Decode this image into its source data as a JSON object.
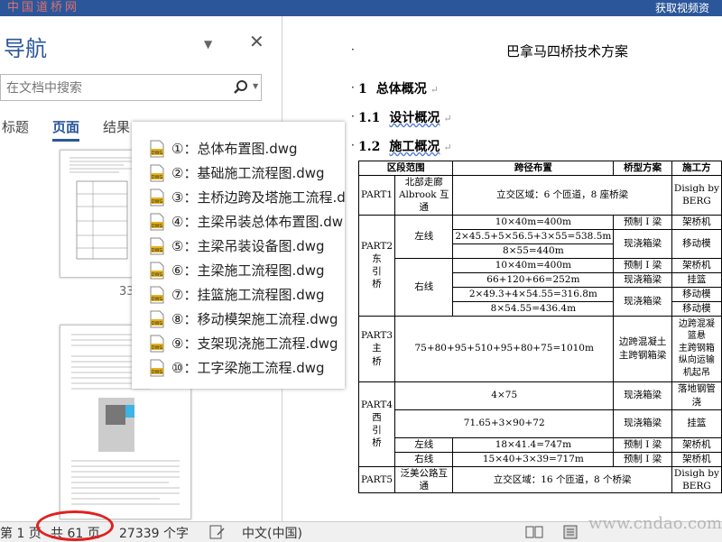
{
  "watermark_top": "中国道桥网",
  "watermark_bottom": "www.cndao.com",
  "ribbon_right": "获取视频资",
  "nav": {
    "title": "导航",
    "search_placeholder": "在文档中搜索",
    "tabs": [
      "标题",
      "页面",
      "结果"
    ],
    "page_number_label": "33"
  },
  "attachments": [
    "①：总体布置图.dwg",
    "②：基础施工流程图.dwg",
    "③：主桥边跨及塔施工流程.d",
    "④：主梁吊装总体布置图.dw",
    "⑤：主梁吊装设备图.dwg",
    "⑥：主梁施工流程图.dwg",
    "⑦：挂篮施工流程图.dwg",
    "⑧：移动模架施工流程.dwg",
    "⑨：支架现浇施工流程.dwg",
    "⑩：工字梁施工流程.dwg"
  ],
  "document": {
    "title": "巴拿马四桥技术方案",
    "headings": [
      {
        "num": "1",
        "text": "总体概况"
      },
      {
        "num": "1.1",
        "text": "设计概况"
      },
      {
        "num": "1.2",
        "text": "施工概况"
      }
    ],
    "table": {
      "headers": [
        "区段范围",
        "跨径布置",
        "桥型方案",
        "施工方"
      ],
      "p1": {
        "part": "PART1",
        "scope": "北部走廊\nAlbrook 互通",
        "span": "立交区域：6 个匝道，8 座桥梁",
        "method": "Disigh by\nBERG"
      },
      "p2": {
        "part": "PART2\n东\n引\n桥",
        "left": "左线",
        "right": "右线",
        "spans": [
          "10×40m=400m",
          "2×45.5+5×56.5+3×55=538.5m",
          "8×55=440m",
          "10×40m=400m",
          "66+120+66=252m",
          "2×49.3+4×54.55=316.8m",
          "8×54.55=436.4m"
        ],
        "types": [
          "预制 I 梁",
          "现浇箱梁",
          "预制 I 梁",
          "现浇箱梁",
          "现浇箱梁"
        ],
        "methods": [
          "架桥机",
          "移动模",
          "架桥机",
          "挂篮",
          "移动模",
          "移动模"
        ]
      },
      "p3": {
        "part": "PART3\n主\n桥",
        "span": "75+80+95+510+95+80+75=1010m",
        "type": "边跨混凝土\n主跨钢箱梁",
        "method": "边跨混凝\n篮悬\n主跨钢箱\n纵向运输\n机起吊"
      },
      "p4": {
        "part": "PART4\n西\n引\n桥",
        "left": "左线",
        "right": "右线",
        "spans": [
          "4×75",
          "71.65+3×90+72",
          "18×41.4=747m",
          "15×40+3×39=717m"
        ],
        "types": [
          "现浇箱梁",
          "现浇箱梁",
          "预制 I 梁",
          "预制 I 梁"
        ],
        "methods": [
          "落地钢管\n浇",
          "挂篮",
          "架桥机",
          "架桥机"
        ]
      },
      "p5": {
        "part": "PART5",
        "scope": "泛美公路互\n通",
        "span": "立交区域：16 个匝道，8 个桥梁",
        "method": "Disigh by\nBERG"
      }
    }
  },
  "status": {
    "page": "第 1 页",
    "total": "共 61 页",
    "words": "27339 个字",
    "lang": "中文(中国)"
  },
  "colors": {
    "accent": "#2b579a",
    "highlight": "#e02020"
  }
}
